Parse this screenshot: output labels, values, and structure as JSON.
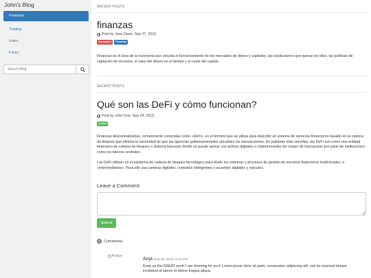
{
  "sidebar": {
    "blog_title": "John's Blog",
    "items": [
      {
        "label": "Finanzas",
        "active": true
      },
      {
        "label": "Trading",
        "active": false
      },
      {
        "label": "Index",
        "active": false
      },
      {
        "label": "Forex",
        "active": false
      }
    ],
    "search": {
      "placeholder": "Search Blog..",
      "icon": "search-icon"
    }
  },
  "main": {
    "section_label_1": "RECENT POSTS",
    "post1": {
      "title": "finanzas",
      "meta": "Post by Jane Dane, Sep 27, 2015.",
      "badges": [
        {
          "label": "conceptos",
          "color": "#d9534f"
        },
        {
          "label": "Finanzas",
          "color": "#337ab7"
        }
      ],
      "body": "Finanzas es el área de la economía que estudia el funcionamiento de los mercados de dinero y capitales, las instituciones que operan en ellos, las políticas de captación de recursos, el valor del dinero en el tiempo y el coste del capital.."
    },
    "section_label_2": "RECENT POSTS",
    "post2": {
      "title": "Qué son las DeFi y cómo funcionan?",
      "meta": "Post by John Doe, Sep 24, 2015.",
      "badges": [
        {
          "label": "Lorem",
          "color": "#5cb85c"
        }
      ],
      "body1": "Finanzas descentralizadas, comúnmente conocidas como «DeFi», es el término que se utiliza para describir un sistema de servicios financieros basado en la cadena de bloques que elimina la necesidad de que las agencias gubernamentales aprueben las transacciones. En palabras más sencillas, las DeFi son como una entidad financiera de cadena de bloques o sistema bancario donde se puede operar con activos digitales o criptomonedas sin costes de transacción por parte de instituciones como los bancos centrales.",
      "body2": "Las DeFi utilizan un ecosistema de cadena de bloques tecnológico para eludir los sistemas y procesos de gestión de servicios financieros tradicionales, o «intermediarios». Para ello usa carteras digitales, contratos inteligentes o acuerdos digitales y oráculos."
    },
    "comment_form": {
      "heading": "Leave a Comment:",
      "submit_label": "Submit"
    },
    "comments": {
      "count": "2",
      "label": "Comments:",
      "items": [
        {
          "avatar_alt": "Avatar",
          "author": "Anja",
          "date": "Sep 29, 2015, 9:12 PM",
          "text": "Keep up the GREAT work! I am cheering for you!! Lorem ipsum dolor sit amet, consectetur adipiscing elit, sed do eiusmod tempor incididunt ut labore et dolore magna aliqua."
        }
      ]
    }
  },
  "colors": {
    "accent": "#337ab7",
    "sidebar_bg": "#f1f1f1",
    "success": "#5cb85c",
    "danger": "#d9534f"
  }
}
